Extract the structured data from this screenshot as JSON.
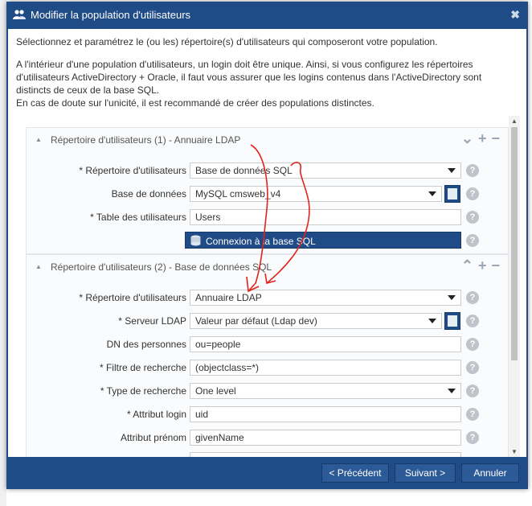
{
  "dialog": {
    "title": "Modifier la population d'utilisateurs",
    "intro_1": "Sélectionnez et paramétrez le (ou les) répertoire(s) d'utilisateurs qui composeront votre population.",
    "intro_2": "A l'intérieur d'une population d'utilisateurs, un login doit être unique. Ainsi, si vous configurez les répertoires d'utilisateurs ActiveDirectory + Oracle, il faut vous assurer que les logins contenus dans l'ActiveDirectory sont distincts de ceux de la base SQL.",
    "intro_3": "En cas de doute sur l'unicité, il est recommandé de créer des populations distinctes."
  },
  "section1": {
    "title": "Répertoire d'utilisateurs (1) - Annuaire LDAP",
    "fields": {
      "repo_label": "* Répertoire d'utilisateurs",
      "repo_value": "Base de données SQL",
      "db_label": "Base de données",
      "db_value": "MySQL cmsweb_v4",
      "table_label": "* Table des utilisateurs",
      "table_value": "Users"
    },
    "connect_button": "Connexion à la base SQL"
  },
  "section2": {
    "title": "Répertoire d'utilisateurs (2) - Base de données SQL",
    "fields": {
      "repo_label": "* Répertoire d'utilisateurs",
      "repo_value": "Annuaire LDAP",
      "server_label": "* Serveur LDAP",
      "server_value": "Valeur par défaut (Ldap dev)",
      "dn_label": "DN des personnes",
      "dn_value": "ou=people",
      "filter_label": "* Filtre de recherche",
      "filter_value": "(objectclass=*)",
      "search_type_label": "* Type de recherche",
      "search_type_value": "One level",
      "login_label": "* Attribut login",
      "login_value": "uid",
      "firstname_label": "Attribut prénom",
      "firstname_value": "givenName"
    }
  },
  "footer": {
    "prev": "< Précédent",
    "next": "Suivant >",
    "cancel": "Annuler"
  },
  "icons": {
    "title": "users-icon",
    "close": "close-icon",
    "collapse": "chevron-up-icon",
    "add": "plus-icon",
    "remove": "minus-icon",
    "help": "help-icon",
    "database": "database-icon",
    "directory": "directory-icon"
  },
  "colors": {
    "accent": "#1f4b86",
    "annotation": "#e0241b"
  }
}
